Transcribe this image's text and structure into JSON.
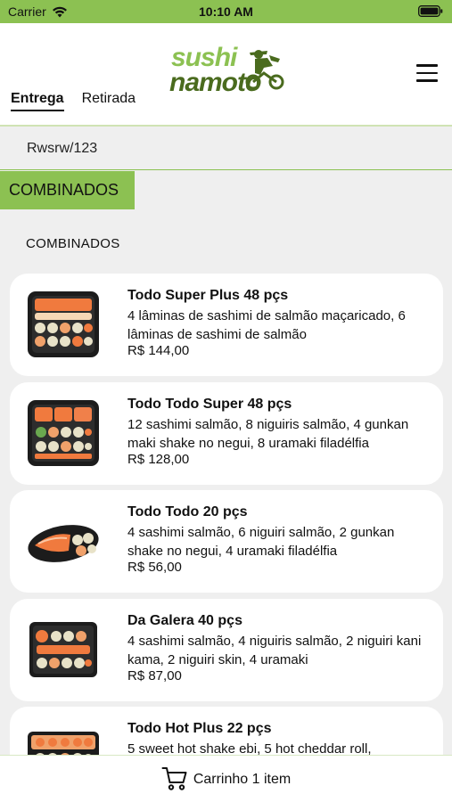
{
  "status_bar": {
    "carrier": "Carrier",
    "time": "10:10 AM",
    "wifi_icon": "wifi-icon",
    "battery_icon": "battery-icon"
  },
  "header": {
    "logo_top": "sushi",
    "logo_bottom": "namoto",
    "menu_icon": "hamburger-menu-icon",
    "tabs": [
      {
        "label": "Entrega",
        "active": true
      },
      {
        "label": "Retirada",
        "active": false
      }
    ]
  },
  "address": {
    "text": "Rwsrw/123"
  },
  "category_tab": {
    "label": "COMBINADOS"
  },
  "section": {
    "title": "COMBINADOS"
  },
  "products": [
    {
      "name": "Todo Super Plus 48 pçs",
      "description": "4 lâminas de sashimi de salmão maçaricado, 6 lâminas de sashimi de salmão",
      "price": "R$ 144,00"
    },
    {
      "name": "Todo Todo Super 48 pçs",
      "description": "12 sashimi salmão, 8 niguiris salmão, 4 gunkan maki shake no negui, 8 uramaki filadélfia",
      "price": "R$ 128,00"
    },
    {
      "name": "Todo Todo 20 pçs",
      "description": "4 sashimi salmão,  6 niguiri salmão, 2 gunkan shake no negui, 4 uramaki filadélfia",
      "price": "R$ 56,00"
    },
    {
      "name": "Da Galera 40 pçs",
      "description": "4 sashimi salmão, 4 niguiris salmão, 2 niguiri kani kama, 2 niguiri skin, 4 uramaki",
      "price": "R$ 87,00"
    },
    {
      "name": "Todo Hot Plus 22 pçs",
      "description": "5 sweet hot shake ebi, 5 hot cheddar roll,",
      "price": ""
    }
  ],
  "cart": {
    "icon": "cart-icon",
    "label": "Carrinho 1 item"
  },
  "colors": {
    "accent": "#8cc152",
    "logo_dark": "#4a6b1e",
    "background": "#efefef",
    "card": "#ffffff"
  }
}
